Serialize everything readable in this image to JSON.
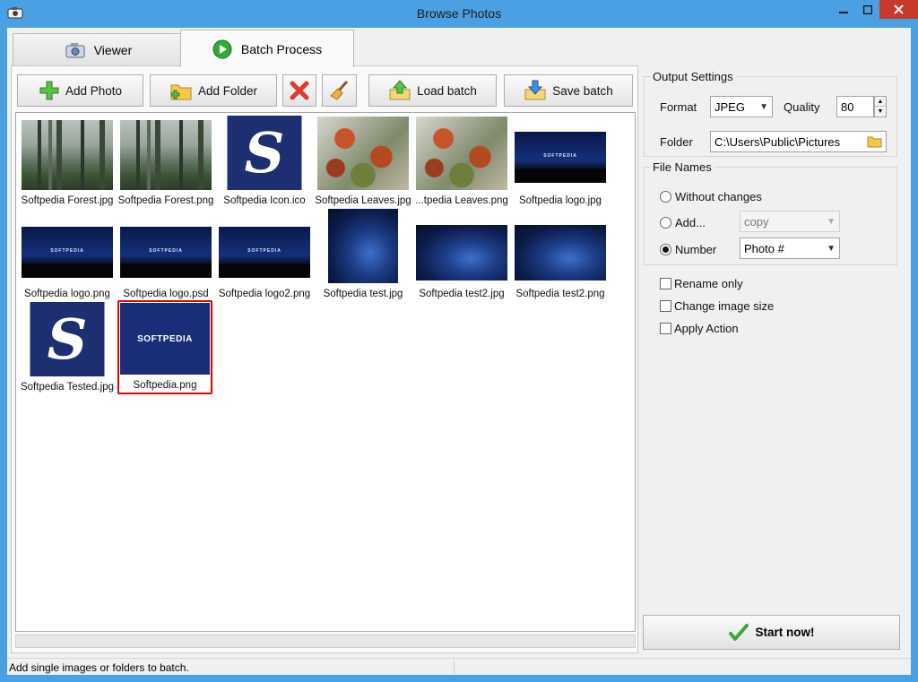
{
  "window": {
    "title": "Browse Photos"
  },
  "tabs": [
    {
      "label": "Viewer"
    },
    {
      "label": "Batch Process"
    }
  ],
  "toolbar": {
    "add_photo": "Add Photo",
    "add_folder": "Add Folder",
    "load_batch": "Load batch",
    "save_batch": "Save batch"
  },
  "gallery": {
    "items": [
      {
        "caption": "Softpedia Forest.jpg",
        "kind": "forest"
      },
      {
        "caption": "Softpedia Forest.png",
        "kind": "forest"
      },
      {
        "caption": "Softpedia Icon.ico",
        "kind": "s-icon"
      },
      {
        "caption": "Softpedia Leaves.jpg",
        "kind": "leaves"
      },
      {
        "caption": "...tpedia Leaves.png",
        "kind": "leaves"
      },
      {
        "caption": "Softpedia logo.jpg",
        "kind": "logo",
        "logo_text": "SOFTPEDIA"
      },
      {
        "caption": "Softpedia logo.png",
        "kind": "logo",
        "logo_text": "SOFTPEDIA"
      },
      {
        "caption": "Softpedia logo.psd",
        "kind": "logo",
        "logo_text": "SOFTPEDIA"
      },
      {
        "caption": "Softpedia logo2.png",
        "kind": "logo",
        "logo_text": "SOFTPEDIA"
      },
      {
        "caption": "Softpedia test.jpg",
        "kind": "swirl"
      },
      {
        "caption": "Softpedia test2.jpg",
        "kind": "swirl"
      },
      {
        "caption": "Softpedia test2.png",
        "kind": "swirl"
      },
      {
        "caption": "Softpedia Tested.jpg",
        "kind": "s-icon"
      },
      {
        "caption": "Softpedia.png",
        "kind": "softpedia-png",
        "logo_text": "SOFTPEDIA",
        "selected": true
      }
    ]
  },
  "output_settings": {
    "legend": "Output Settings",
    "format_label": "Format",
    "format_value": "JPEG",
    "quality_label": "Quality",
    "quality_value": "80",
    "folder_label": "Folder",
    "folder_value": "C:\\Users\\Public\\Pictures"
  },
  "file_names": {
    "legend": "File Names",
    "without_changes": "Without changes",
    "add_label": "Add...",
    "add_value": "copy",
    "number_label": "Number",
    "number_value": "Photo #",
    "selected": "Number"
  },
  "options": {
    "rename_only": "Rename only",
    "change_size": "Change image size",
    "apply_action": "Apply Action"
  },
  "start_button": "Start now!",
  "status": {
    "text": "Add single images or folders to batch."
  },
  "colors": {
    "titlebar": "#4aa0e3",
    "close": "#c7392b",
    "selection": "#e00000"
  }
}
